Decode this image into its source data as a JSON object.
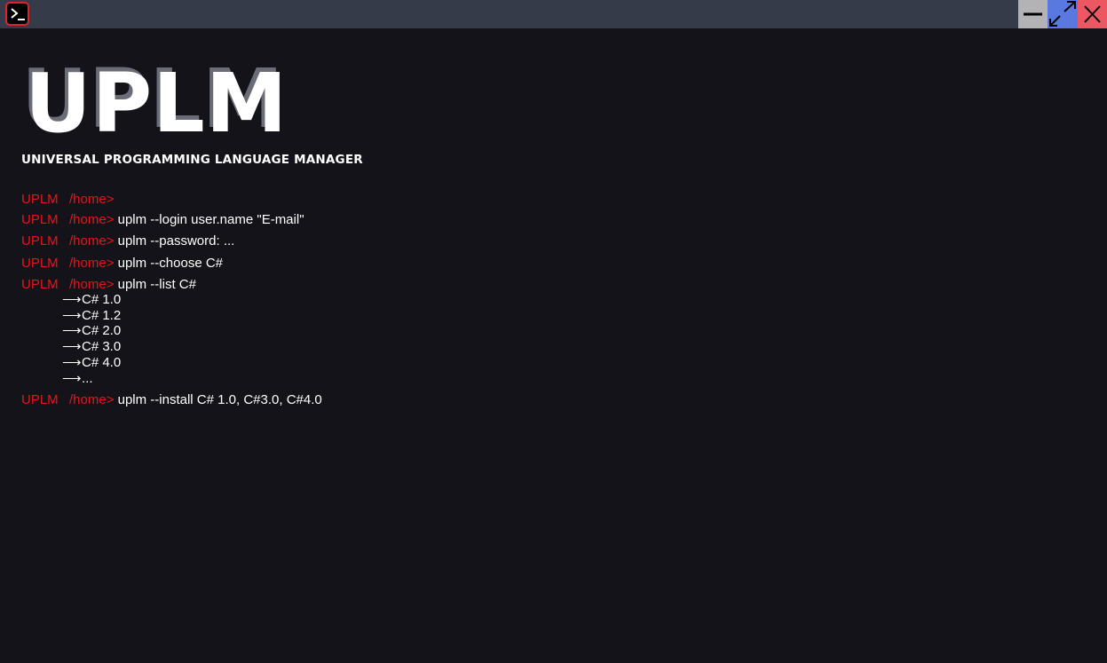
{
  "window": {
    "min_icon": "minimize-icon",
    "max_icon": "maximize-icon",
    "close_icon": "close-icon",
    "app_icon": "terminal-icon"
  },
  "logo": {
    "text": "UPLM",
    "subtitle": "Universal Programming Language Manager"
  },
  "prompt": {
    "name": "UPLM",
    "path": "/home>"
  },
  "commands": [
    "",
    "uplm --login user.name \"E-mail\"",
    "uplm --password: ...",
    "uplm --choose C#",
    "uplm --list C#",
    "uplm --install C# 1.0, C#3.0, C#4.0"
  ],
  "list_output": {
    "arrow": "⟶",
    "items": [
      "C# 1.0",
      "C# 1.2",
      "C# 2.0",
      "C# 3.0",
      "C# 4.0",
      "..."
    ]
  },
  "colors": {
    "background": "#131319",
    "titlebar": "#363b49",
    "prompt": "#e8141c",
    "text": "#ffffff"
  }
}
